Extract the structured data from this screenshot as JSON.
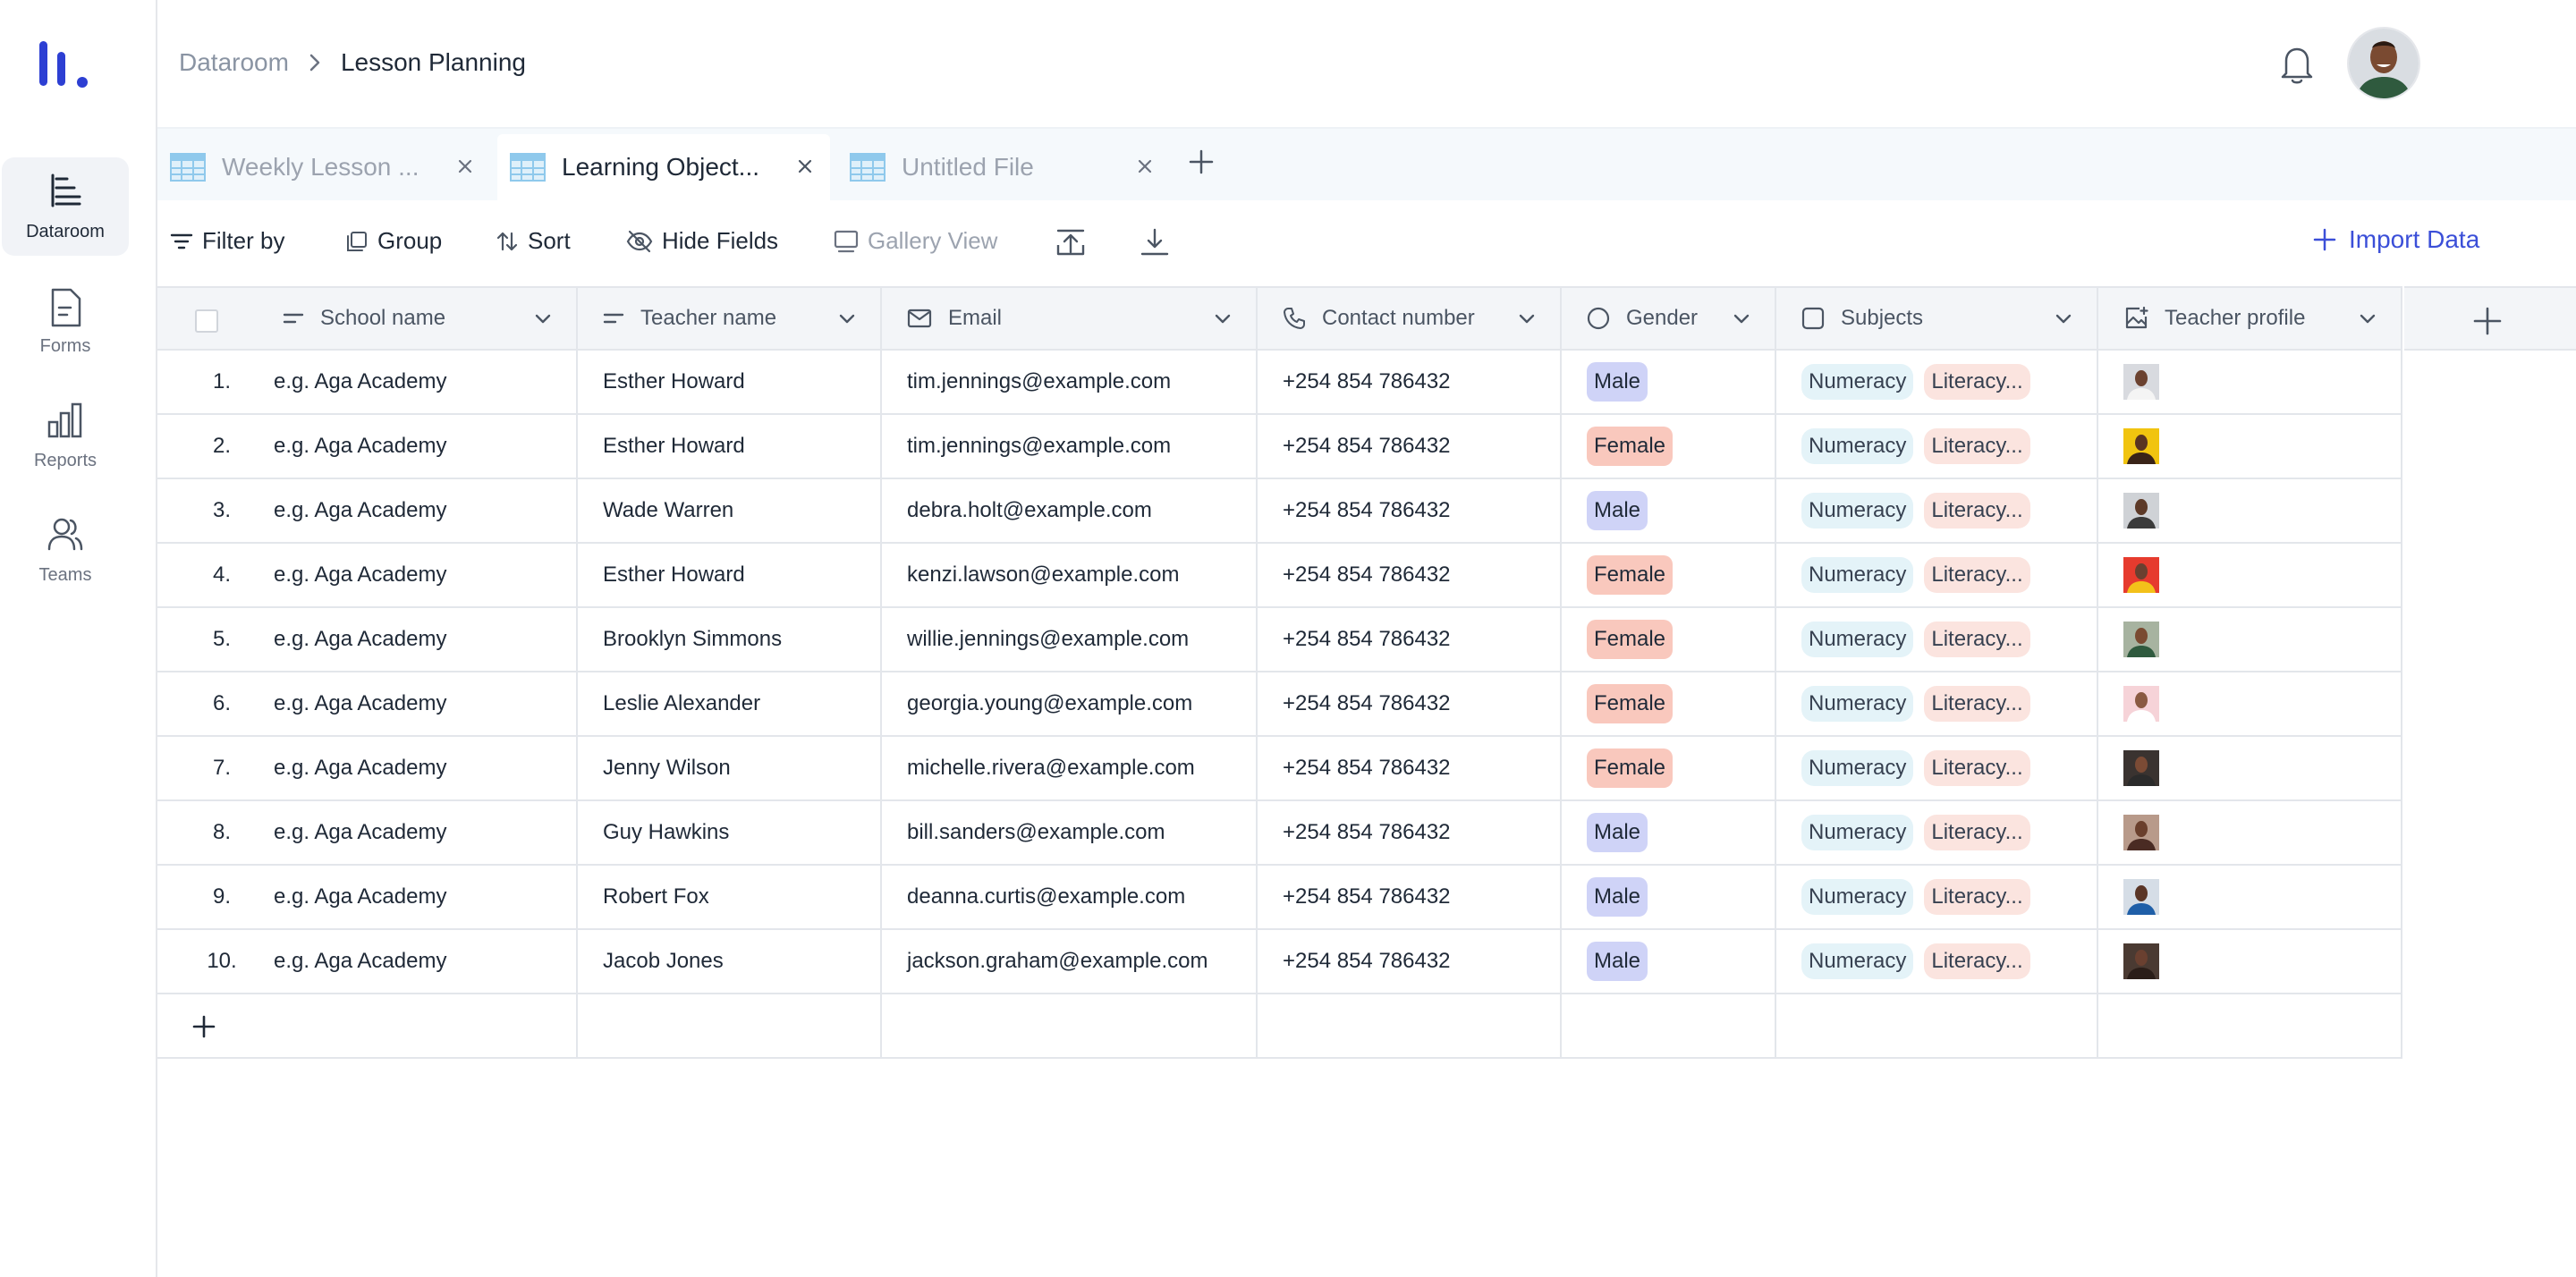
{
  "sidebar": {
    "items": [
      {
        "label": "Dataroom",
        "icon": "dataroom-icon",
        "active": true
      },
      {
        "label": "Forms",
        "icon": "document-icon",
        "active": false
      },
      {
        "label": "Reports",
        "icon": "bar-chart-icon",
        "active": false
      },
      {
        "label": "Teams",
        "icon": "users-icon",
        "active": false
      }
    ]
  },
  "header": {
    "breadcrumb_root": "Dataroom",
    "breadcrumb_current": "Lesson Planning"
  },
  "tabs": [
    {
      "label": "Weekly Lesson ...",
      "active": false
    },
    {
      "label": "Learning Object...",
      "active": true
    },
    {
      "label": "Untitled File",
      "active": false
    }
  ],
  "toolbar": {
    "filter": "Filter by",
    "group": "Group",
    "sort": "Sort",
    "hide_fields": "Hide Fields",
    "gallery_view": "Gallery View",
    "import_data": "Import Data"
  },
  "table": {
    "columns": [
      "School name",
      "Teacher name",
      "Email",
      "Contact number",
      "Gender",
      "Subjects",
      "Teacher profile"
    ],
    "rows": [
      {
        "num": "1.",
        "school": "e.g. Aga Academy",
        "teacher": "Esther Howard",
        "email": "tim.jennings@example.com",
        "phone": "+254 854 786432",
        "gender": "Male",
        "subjects": [
          "Numeracy",
          "Literacy..."
        ]
      },
      {
        "num": "2.",
        "school": "e.g. Aga Academy",
        "teacher": "Esther Howard",
        "email": "tim.jennings@example.com",
        "phone": "+254 854 786432",
        "gender": "Female",
        "subjects": [
          "Numeracy",
          "Literacy..."
        ]
      },
      {
        "num": "3.",
        "school": "e.g. Aga Academy",
        "teacher": "Wade Warren",
        "email": "debra.holt@example.com",
        "phone": "+254 854 786432",
        "gender": "Male",
        "subjects": [
          "Numeracy",
          "Literacy..."
        ]
      },
      {
        "num": "4.",
        "school": "e.g. Aga Academy",
        "teacher": "Esther Howard",
        "email": "kenzi.lawson@example.com",
        "phone": "+254 854 786432",
        "gender": "Female",
        "subjects": [
          "Numeracy",
          "Literacy..."
        ]
      },
      {
        "num": "5.",
        "school": "e.g. Aga Academy",
        "teacher": "Brooklyn Simmons",
        "email": "willie.jennings@example.com",
        "phone": "+254 854 786432",
        "gender": "Female",
        "subjects": [
          "Numeracy",
          "Literacy..."
        ]
      },
      {
        "num": "6.",
        "school": "e.g. Aga Academy",
        "teacher": "Leslie Alexander",
        "email": "georgia.young@example.com",
        "phone": "+254 854 786432",
        "gender": "Female",
        "subjects": [
          "Numeracy",
          "Literacy..."
        ]
      },
      {
        "num": "7.",
        "school": "e.g. Aga Academy",
        "teacher": "Jenny Wilson",
        "email": "michelle.rivera@example.com",
        "phone": "+254 854 786432",
        "gender": "Female",
        "subjects": [
          "Numeracy",
          "Literacy..."
        ]
      },
      {
        "num": "8.",
        "school": "e.g. Aga Academy",
        "teacher": "Guy Hawkins",
        "email": "bill.sanders@example.com",
        "phone": "+254 854 786432",
        "gender": "Male",
        "subjects": [
          "Numeracy",
          "Literacy..."
        ]
      },
      {
        "num": "9.",
        "school": "e.g. Aga Academy",
        "teacher": "Robert Fox",
        "email": "deanna.curtis@example.com",
        "phone": "+254 854 786432",
        "gender": "Male",
        "subjects": [
          "Numeracy",
          "Literacy..."
        ]
      },
      {
        "num": "10.",
        "school": "e.g. Aga Academy",
        "teacher": "Jacob Jones",
        "email": "jackson.graham@example.com",
        "phone": "+254 854 786432",
        "gender": "Male",
        "subjects": [
          "Numeracy",
          "Literacy..."
        ]
      }
    ]
  },
  "colors": {
    "accent": "#3b4fd8",
    "male_pill": "#cfd3f7",
    "female_pill": "#f9c8bd",
    "numeracy_pill": "#e4f3f8",
    "literacy_pill": "#fbe4df"
  }
}
